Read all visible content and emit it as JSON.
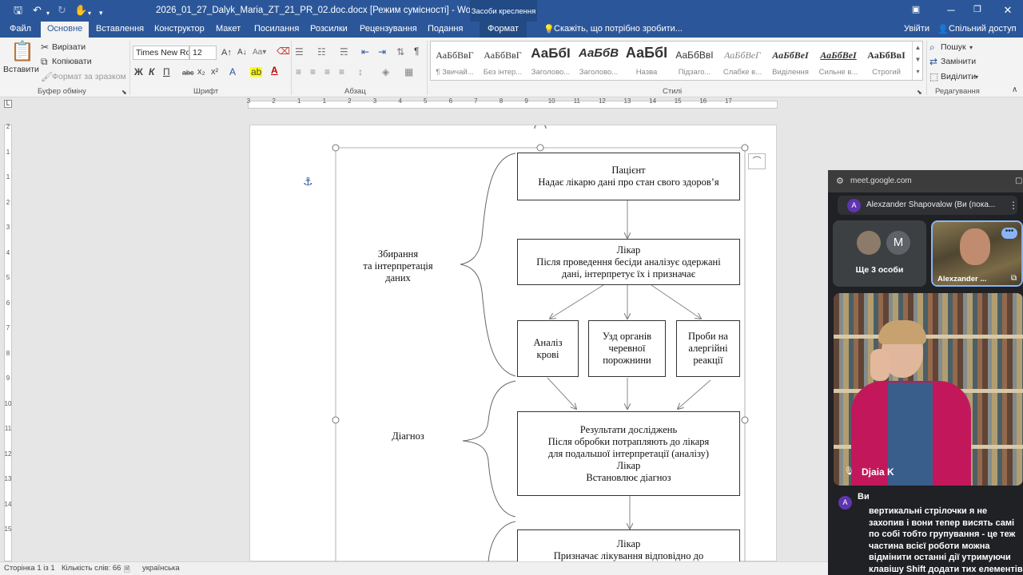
{
  "titlebar": {
    "document_title": "2026_01_27_Dalyk_Maria_ZT_21_PR_02.doc.docx [Режим сумісності] - Word",
    "contextual_group": "Засоби креслення",
    "save_icon": "save-icon",
    "undo_icon": "undo-icon",
    "redo_icon": "redo-icon",
    "touch_icon": "touch-mode-icon"
  },
  "tabs": [
    {
      "label": "Файл"
    },
    {
      "label": "Основне"
    },
    {
      "label": "Вставлення"
    },
    {
      "label": "Конструктор"
    },
    {
      "label": "Макет"
    },
    {
      "label": "Посилання"
    },
    {
      "label": "Розсилки"
    },
    {
      "label": "Рецензування"
    },
    {
      "label": "Подання"
    },
    {
      "label": "Формат"
    }
  ],
  "tellme": "Скажіть, що потрібно зробити...",
  "signin": "Увійти",
  "share": "Спільний доступ",
  "ribbon": {
    "clipboard": {
      "paste": "Вставити",
      "cut": "Вирізати",
      "copy": "Копіювати",
      "format_painter": "Формат за зразком",
      "label": "Буфер обміну"
    },
    "font": {
      "name": "Times New Ro",
      "size": "12",
      "label": "Шрифт",
      "bold": "Ж",
      "italic": "К",
      "underline": "П",
      "strike": "abc",
      "subscript": "x₂",
      "superscript": "x²"
    },
    "paragraph": {
      "label": "Абзац",
      "pilcrow": "¶"
    },
    "styles": {
      "label": "Стилі",
      "items": [
        {
          "preview": "АаБбВвГ",
          "name": "¶ Звичай..."
        },
        {
          "preview": "АаБбВвГ",
          "name": "Без інтер..."
        },
        {
          "preview": "АаБбІ",
          "name": "Заголово..."
        },
        {
          "preview": "АаБбВ",
          "name": "Заголово..."
        },
        {
          "preview": "АаБбІ",
          "name": "Назва"
        },
        {
          "preview": "АаБбВвІ",
          "name": "Підзаго..."
        },
        {
          "preview": "АаБбВеГ",
          "name": "Слабке в..."
        },
        {
          "preview": "АаБбВеІ",
          "name": "Виділення"
        },
        {
          "preview": "АаБбВеІ",
          "name": "Сильне в..."
        },
        {
          "preview": "АаБбВвІ",
          "name": "Строгий"
        }
      ]
    },
    "editing": {
      "find": "Пошук",
      "replace": "Замінити",
      "select": "Виділити",
      "label": "Редагування"
    }
  },
  "ruler": {
    "h_numbers": [
      "3",
      "2",
      "1",
      "1",
      "2",
      "3",
      "4",
      "5",
      "6",
      "7",
      "8",
      "9",
      "10",
      "11",
      "12",
      "13",
      "14",
      "15",
      "16",
      "17"
    ],
    "v_numbers": [
      "2",
      "1",
      "1",
      "2",
      "3",
      "4",
      "5",
      "6",
      "7",
      "8",
      "9",
      "10",
      "11",
      "12",
      "13",
      "14",
      "15"
    ]
  },
  "diagram": {
    "group_label_1": "Збирання\nта інтерпретація\nданих",
    "group_label_2": "Діагноз",
    "boxes": [
      {
        "line1": "Пацієнт",
        "line2": "Надає лікарю дані про стан свого здоров’я"
      },
      {
        "line1": "Лікар",
        "line2": "Після проведення бесіди аналізує одержані\nдані, інтерпретує їх і призначає"
      },
      {
        "text": "Аналіз\nкрові"
      },
      {
        "text": "Узд органів\nчеревної\nпорожнини"
      },
      {
        "text": "Проби на\nалергійні\nреакції"
      },
      {
        "text": "Результати досліджень\nПісля обробки потрапляють до лікаря\nдля подальшої інтерпретації (аналізу)\nЛікар\nВстановлює діагноз"
      },
      {
        "line1": "Лікар",
        "line2": "Призначає лікування відповідно до"
      }
    ]
  },
  "status": {
    "page": "Сторінка 1 із 1",
    "words": "Кількість слів: 66",
    "language": "українська"
  },
  "meet": {
    "url": "meet.google.com",
    "presenter": "Alexzander Shapovalow (Ви (пока...",
    "presenter_initial": "A",
    "others": "Ще 3 особи",
    "others_initial": "M",
    "tile_name": "Alexzander ...",
    "speaker_name": "Djaia K",
    "chat_author": "Ви",
    "chat_initial": "A",
    "chat_lines": [
      "вертикальні стрілочки я не",
      "захопив і вони тепер висять самі",
      "по собі тобто групування - це теж",
      "частина всієї роботи можна",
      "відмінити останні дії утримуючи",
      "клавішу Shift додати тих елементів"
    ]
  },
  "colors": {
    "word_blue": "#2b579a",
    "meet_bg": "#202124",
    "accent_purple": "#5e35b1"
  }
}
